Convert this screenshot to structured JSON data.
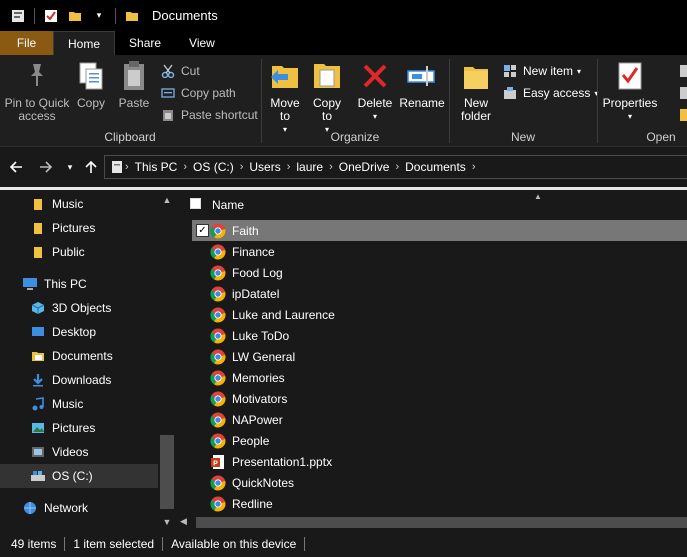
{
  "window": {
    "title": "Documents"
  },
  "tabs": [
    "File",
    "Home",
    "Share",
    "View"
  ],
  "ribbon": {
    "clipboard": {
      "label": "Clipboard",
      "pin": "Pin to Quick access",
      "copy": "Copy",
      "paste": "Paste",
      "cut": "Cut",
      "copy_path": "Copy path",
      "paste_shortcut": "Paste shortcut"
    },
    "organize": {
      "label": "Organize",
      "move_to": "Move to",
      "copy_to": "Copy to",
      "delete": "Delete",
      "rename": "Rename"
    },
    "new": {
      "label": "New",
      "new_folder": "New folder",
      "new_item": "New item",
      "easy_access": "Easy access"
    },
    "open": {
      "label": "Open",
      "properties": "Properties"
    }
  },
  "address": {
    "crumbs": [
      "This PC",
      "OS (C:)",
      "Users",
      "laure",
      "OneDrive",
      "Documents"
    ]
  },
  "nav": {
    "items": [
      {
        "label": "Music",
        "icon": "folder-icon"
      },
      {
        "label": "Pictures",
        "icon": "folder-icon"
      },
      {
        "label": "Public",
        "icon": "folder-icon"
      },
      {
        "label": "This PC",
        "icon": "computer-icon"
      },
      {
        "label": "3D Objects",
        "icon": "3d-objects-icon"
      },
      {
        "label": "Desktop",
        "icon": "desktop-icon"
      },
      {
        "label": "Documents",
        "icon": "documents-icon"
      },
      {
        "label": "Downloads",
        "icon": "downloads-icon"
      },
      {
        "label": "Music",
        "icon": "music-icon"
      },
      {
        "label": "Pictures",
        "icon": "pictures-icon"
      },
      {
        "label": "Videos",
        "icon": "videos-icon"
      },
      {
        "label": "OS (C:)",
        "icon": "drive-icon"
      },
      {
        "label": "Network",
        "icon": "network-icon"
      }
    ]
  },
  "filelist": {
    "header_name": "Name",
    "files": [
      {
        "name": "Faith",
        "icon": "chrome-icon"
      },
      {
        "name": "Finance",
        "icon": "chrome-icon"
      },
      {
        "name": "Food Log",
        "icon": "chrome-icon"
      },
      {
        "name": "ipDatatel",
        "icon": "chrome-icon"
      },
      {
        "name": "Luke and Laurence",
        "icon": "chrome-icon"
      },
      {
        "name": "Luke ToDo",
        "icon": "chrome-icon"
      },
      {
        "name": "LW General",
        "icon": "chrome-icon"
      },
      {
        "name": "Memories",
        "icon": "chrome-icon"
      },
      {
        "name": "Motivators",
        "icon": "chrome-icon"
      },
      {
        "name": "NAPower",
        "icon": "chrome-icon"
      },
      {
        "name": "People",
        "icon": "chrome-icon"
      },
      {
        "name": "Presentation1.pptx",
        "icon": "powerpoint-icon"
      },
      {
        "name": "QuickNotes",
        "icon": "chrome-icon"
      },
      {
        "name": "Redline",
        "icon": "chrome-icon"
      }
    ]
  },
  "status": {
    "count": "49 items",
    "selected": "1 item selected",
    "availability": "Available on this device"
  },
  "colors": {
    "accent_file_tab": "#8a5a12",
    "background": "#191919",
    "selected_row": "#777777"
  }
}
